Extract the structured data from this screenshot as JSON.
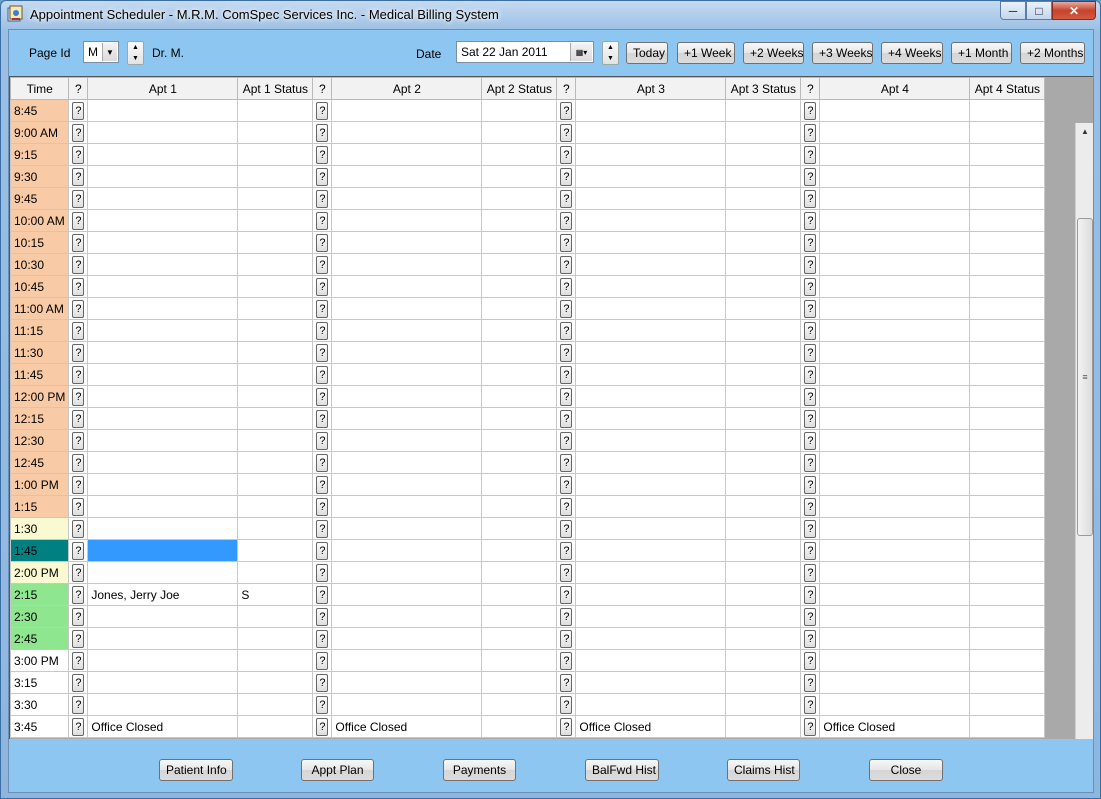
{
  "window": {
    "title": "Appointment Scheduler - M.R.M. ComSpec Services Inc. - Medical Billing System"
  },
  "toolbar": {
    "page_id_label": "Page Id",
    "page_id_value": "M",
    "doctor_label": "Dr. M.",
    "date_label": "Date",
    "date_value": "Sat  22 Jan  2011",
    "buttons": [
      "Today",
      "+1 Week",
      "+2 Weeks",
      "+3 Weeks",
      "+4 Weeks",
      "+1 Month",
      "+2 Months"
    ]
  },
  "grid": {
    "columns": [
      "Time",
      "?",
      "Apt 1",
      "Apt 1 Status",
      "?",
      "Apt 2",
      "Apt 2 Status",
      "?",
      "Apt 3",
      "Apt 3 Status",
      "?",
      "Apt 4",
      "Apt 4 Status"
    ],
    "rows": [
      {
        "time": "8:45",
        "cells": [
          "",
          "",
          "",
          "",
          "",
          "",
          "",
          ""
        ]
      },
      {
        "time": "9:00 AM",
        "cells": [
          "",
          "",
          "",
          "",
          "",
          "",
          "",
          ""
        ]
      },
      {
        "time": "9:15",
        "cells": [
          "",
          "",
          "",
          "",
          "",
          "",
          "",
          ""
        ]
      },
      {
        "time": "9:30",
        "cells": [
          "",
          "",
          "",
          "",
          "",
          "",
          "",
          ""
        ]
      },
      {
        "time": "9:45",
        "cells": [
          "",
          "",
          "",
          "",
          "",
          "",
          "",
          ""
        ]
      },
      {
        "time": "10:00 AM",
        "cells": [
          "",
          "",
          "",
          "",
          "",
          "",
          "",
          ""
        ]
      },
      {
        "time": "10:15",
        "cells": [
          "",
          "",
          "",
          "",
          "",
          "",
          "",
          ""
        ]
      },
      {
        "time": "10:30",
        "cells": [
          "",
          "",
          "",
          "",
          "",
          "",
          "",
          ""
        ]
      },
      {
        "time": "10:45",
        "cells": [
          "",
          "",
          "",
          "",
          "",
          "",
          "",
          ""
        ]
      },
      {
        "time": "11:00 AM",
        "cells": [
          "",
          "",
          "",
          "",
          "",
          "",
          "",
          ""
        ]
      },
      {
        "time": "11:15",
        "cells": [
          "",
          "",
          "",
          "",
          "",
          "",
          "",
          ""
        ]
      },
      {
        "time": "11:30",
        "cells": [
          "",
          "",
          "",
          "",
          "",
          "",
          "",
          ""
        ]
      },
      {
        "time": "11:45",
        "cells": [
          "",
          "",
          "",
          "",
          "",
          "",
          "",
          ""
        ]
      },
      {
        "time": "12:00 PM",
        "cells": [
          "",
          "",
          "",
          "",
          "",
          "",
          "",
          ""
        ]
      },
      {
        "time": "12:15",
        "cells": [
          "",
          "",
          "",
          "",
          "",
          "",
          "",
          ""
        ]
      },
      {
        "time": "12:30",
        "cells": [
          "",
          "",
          "",
          "",
          "",
          "",
          "",
          ""
        ]
      },
      {
        "time": "12:45",
        "cells": [
          "",
          "",
          "",
          "",
          "",
          "",
          "",
          ""
        ]
      },
      {
        "time": "1:00 PM",
        "cells": [
          "",
          "",
          "",
          "",
          "",
          "",
          "",
          ""
        ]
      },
      {
        "time": "1:15",
        "cells": [
          "",
          "",
          "",
          "",
          "",
          "",
          "",
          ""
        ]
      },
      {
        "time": "1:30",
        "cells": [
          "",
          "",
          "",
          "",
          "",
          "",
          "",
          ""
        ]
      },
      {
        "time": "1:45",
        "cells": [
          "",
          "",
          "",
          "",
          "",
          "",
          "",
          ""
        ]
      },
      {
        "time": "2:00 PM",
        "cells": [
          "",
          "",
          "",
          "",
          "",
          "",
          "",
          ""
        ]
      },
      {
        "time": "2:15",
        "cells": [
          "Jones, Jerry Joe",
          "S",
          "",
          "",
          "",
          "",
          "",
          ""
        ]
      },
      {
        "time": "2:30",
        "cells": [
          "",
          "",
          "",
          "",
          "",
          "",
          "",
          ""
        ]
      },
      {
        "time": "2:45",
        "cells": [
          "",
          "",
          "",
          "",
          "",
          "",
          "",
          ""
        ]
      },
      {
        "time": "3:00 PM",
        "cells": [
          "",
          "",
          "",
          "",
          "",
          "",
          "",
          ""
        ]
      },
      {
        "time": "3:15",
        "cells": [
          "",
          "",
          "",
          "",
          "",
          "",
          "",
          ""
        ]
      },
      {
        "time": "3:30",
        "cells": [
          "",
          "",
          "",
          "",
          "",
          "",
          "",
          ""
        ]
      },
      {
        "time": "3:45",
        "cells": [
          "Office Closed",
          "",
          "Office Closed",
          "",
          "Office Closed",
          "",
          "Office Closed",
          ""
        ]
      }
    ],
    "row_colors": {
      "morning": "#f8cba6",
      "mid": "#fafad2",
      "selected": "#008080",
      "booked": "#8ee68e",
      "late": "#ffffff",
      "selected_cell": "#3399ff"
    }
  },
  "footer": {
    "buttons": [
      "Patient Info",
      "Appt Plan",
      "Payments",
      "BalFwd Hist",
      "Claims Hist",
      "Close"
    ]
  }
}
